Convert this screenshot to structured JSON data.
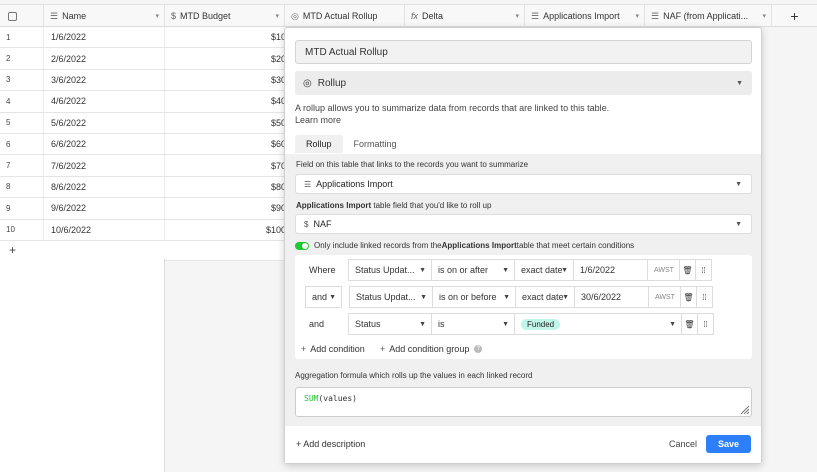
{
  "grid": {
    "columns": [
      {
        "icon": "☰",
        "label": "Name"
      },
      {
        "icon": "$",
        "label": "MTD Budget"
      },
      {
        "icon": "◎",
        "label": "MTD Actual Rollup"
      },
      {
        "icon": "fx",
        "label": "Delta"
      },
      {
        "icon": "☰",
        "label": "Applications Import"
      },
      {
        "icon": "☰",
        "label": "NAF (from Applicati..."
      }
    ],
    "rows": [
      {
        "num": "1",
        "name": "1/6/2022",
        "budget": "$10"
      },
      {
        "num": "2",
        "name": "2/6/2022",
        "budget": "$20"
      },
      {
        "num": "3",
        "name": "3/6/2022",
        "budget": "$30"
      },
      {
        "num": "4",
        "name": "4/6/2022",
        "budget": "$40"
      },
      {
        "num": "5",
        "name": "5/6/2022",
        "budget": "$50"
      },
      {
        "num": "6",
        "name": "6/6/2022",
        "budget": "$60"
      },
      {
        "num": "7",
        "name": "7/6/2022",
        "budget": "$70"
      },
      {
        "num": "8",
        "name": "8/6/2022",
        "budget": "$80"
      },
      {
        "num": "9",
        "name": "9/6/2022",
        "budget": "$90"
      },
      {
        "num": "10",
        "name": "10/6/2022",
        "budget": "$100"
      }
    ],
    "add_row": "+",
    "add_column": "+"
  },
  "panel": {
    "field_name": "MTD Actual Rollup",
    "field_type": "Rollup",
    "description_line1": "A rollup allows you to summarize data from records that are linked to this table.",
    "learn_more": "Learn more",
    "tabs": [
      "Rollup",
      "Formatting"
    ],
    "link_field_label": "Field on this table that links to the records you want to summarize",
    "link_field_value": "Applications Import",
    "rollup_field_label_bold": "Applications Import",
    "rollup_field_label_rest": " table field that you'd like to roll up",
    "rollup_field_value": "NAF",
    "toggle_text_1": "Only include linked records from the ",
    "toggle_text_bold": "Applications Import",
    "toggle_text_2": " table that meet certain conditions",
    "conditions": [
      {
        "conj": "Where",
        "field": "Status Updat...",
        "op": "is on or after",
        "mode": "exact date",
        "value": "1/6/2022",
        "tz": "AWST"
      },
      {
        "conj": "and",
        "field": "Status Updat...",
        "op": "is on or before",
        "mode": "exact date",
        "value": "30/6/2022",
        "tz": "AWST"
      },
      {
        "conj": "and",
        "field": "Status",
        "op": "is",
        "value": "Funded"
      }
    ],
    "add_condition": "Add condition",
    "add_condition_group": "Add condition group",
    "aggregation_label": "Aggregation formula which rolls up the values in each linked record",
    "formula_fn": "SUM",
    "formula_args": "(values)",
    "add_description": "Add description",
    "cancel": "Cancel",
    "save": "Save"
  },
  "colors": {
    "accent": "#2d7ff9",
    "toggle": "#20c933",
    "pill": "#c2f5e9"
  }
}
